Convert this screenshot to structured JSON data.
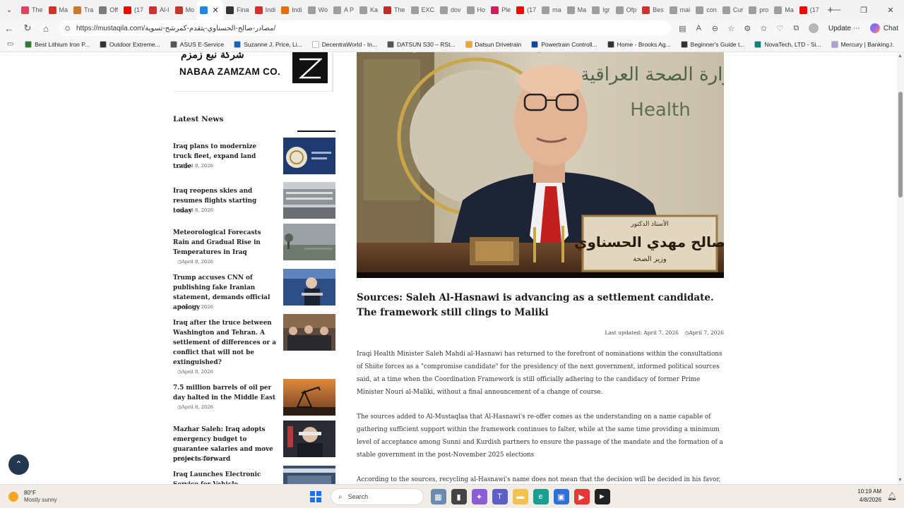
{
  "browser": {
    "tabs": [
      {
        "label": "The",
        "color": "#e4405f"
      },
      {
        "label": "Ma",
        "color": "#d93025"
      },
      {
        "label": "Tra",
        "color": "#c8772e"
      },
      {
        "label": "Off",
        "color": "#7b7b7b"
      },
      {
        "label": "(17",
        "color": "#ff0000"
      },
      {
        "label": "Al-I",
        "color": "#d32f2f"
      },
      {
        "label": "Mo",
        "color": "#c0392b"
      },
      {
        "label": "",
        "color": "#1e88e5",
        "active": true
      },
      {
        "label": "Fina",
        "color": "#333333"
      },
      {
        "label": "Indi",
        "color": "#d32f2f"
      },
      {
        "label": "Indi",
        "color": "#ef6c00"
      },
      {
        "label": "Wo",
        "color": "#9e9e9e"
      },
      {
        "label": "A P",
        "color": "#9e9e9e"
      },
      {
        "label": "Ka",
        "color": "#9e9e9e"
      },
      {
        "label": "The",
        "color": "#c62828"
      },
      {
        "label": "EXC",
        "color": "#9e9e9e"
      },
      {
        "label": "dov",
        "color": "#9e9e9e"
      },
      {
        "label": "Ho",
        "color": "#9e9e9e"
      },
      {
        "label": "Ple",
        "color": "#d81b60"
      },
      {
        "label": "(17",
        "color": "#ff0000"
      },
      {
        "label": "ma",
        "color": "#9e9e9e"
      },
      {
        "label": "Ma",
        "color": "#9e9e9e"
      },
      {
        "label": "Igr",
        "color": "#9e9e9e"
      },
      {
        "label": "Ofp",
        "color": "#9e9e9e"
      },
      {
        "label": "Bes",
        "color": "#d32f2f"
      },
      {
        "label": "mai",
        "color": "#9e9e9e"
      },
      {
        "label": "con",
        "color": "#9e9e9e"
      },
      {
        "label": "Cur",
        "color": "#9e9e9e"
      },
      {
        "label": "pro",
        "color": "#9e9e9e"
      },
      {
        "label": "Ma",
        "color": "#9e9e9e"
      },
      {
        "label": "(17",
        "color": "#ff0000"
      }
    ],
    "url": "https://mustaqila.com/مصادر-صالح-الحسناوي-يتقدم-كمرشح-تسوية/",
    "update_label": "Update",
    "chat_label": "Chat",
    "bookmarks": [
      {
        "label": "Best Lithium Iron P...",
        "color": "#2e7d32"
      },
      {
        "label": "Outdoor Extreme...",
        "color": "#333333"
      },
      {
        "label": "ASUS E-Service",
        "color": "#555555"
      },
      {
        "label": "Suzanne J. Price, Li...",
        "color": "#1565c0"
      },
      {
        "label": "DecentraWorld - In...",
        "color": "#ffffff"
      },
      {
        "label": "DATSUN S30 – RSt...",
        "color": "#555555"
      },
      {
        "label": "Datsun Drivetrain",
        "color": "#f9a825"
      },
      {
        "label": "Powertrain Controll...",
        "color": "#0d47a1"
      },
      {
        "label": "Home - Brooks Ag...",
        "color": "#333333"
      },
      {
        "label": "Beginner's Guide t...",
        "color": "#333333"
      },
      {
        "label": "NovaTech, LTD - Si...",
        "color": "#00897b"
      },
      {
        "label": "Mercury | Banking...",
        "color": "#b39ddb"
      }
    ]
  },
  "ad": {
    "arabic": "شركة نبع زمزم",
    "name": "NABAA ZAMZAM CO."
  },
  "sidebar": {
    "heading": "Latest News",
    "items": [
      {
        "title": "Iraq plans to modernize truck fleet, expand land trade",
        "date": "April 8, 2026"
      },
      {
        "title": "Iraq reopens skies and resumes flights starting today",
        "date": "April 8, 2026"
      },
      {
        "title": "Meteorological Forecasts Rain and Gradual Rise in Temperatures in Iraq",
        "date": "April 8, 2026"
      },
      {
        "title": "Trump accuses CNN of publishing fake Iranian statement, demands official apology",
        "date": "April 8, 2026"
      },
      {
        "title": "Iraq after the truce between Washington and Tehran. A settlement of differences or a conflict that will not be extinguished?",
        "date": "April 8, 2026"
      },
      {
        "title": "7.5 million barrels of oil per day halted in the Middle East",
        "date": "April 8, 2026"
      },
      {
        "title": "Mazhar Saleh: Iraq adopts emergency budget to guarantee salaries and move projects forward",
        "date": "April 8, 2026"
      },
      {
        "title": "Iraq Launches Electronic Service for Vehicle Ownership Booking",
        "date": ""
      }
    ]
  },
  "article": {
    "nameplate_top": "الأستاذ الدكتور",
    "nameplate_name": "صالح مهدي الحسناوي",
    "nameplate_role": "وزير الصحة",
    "wall_text": "وزارة الصحة العراقية",
    "title": "Sources: Saleh Al-Hasnawi is advancing as a settlement candidate. The framework still clings to Maliki",
    "last_updated": "Last updated: April 7, 2026",
    "published": "April 7, 2026",
    "paragraphs": [
      "Iraqi Health Minister Saleh Mahdi al-Hasnawi has returned to the forefront of nominations within the consultations of Shiite forces as a \"compromise candidate\" for the presidency of the next government, informed political sources said, at a time when the Coordination Framework is still officially adhering to the candidacy of former Prime Minister Nouri al-Maliki, without a final announcement of a change of course.",
      "The sources added to Al-Mustaqlaa that Al-Hasnawi's re-offer comes as the understanding on a name capable of gathering sufficient support within the framework continues to falter, while at the same time providing a minimum level of acceptance among Sunni and Kurdish partners to ensure the passage of the mandate and the formation of a stable government in the post-November 2025 elections",
      "According to the sources, recycling al-Hasnawi's name does not mean that the decision will be decided in his favor, but"
    ]
  },
  "taskbar": {
    "temperature": "80°F",
    "condition": "Mostly sunny",
    "search_placeholder": "Search",
    "time": "10:19 AM",
    "date": "4/8/2026"
  }
}
